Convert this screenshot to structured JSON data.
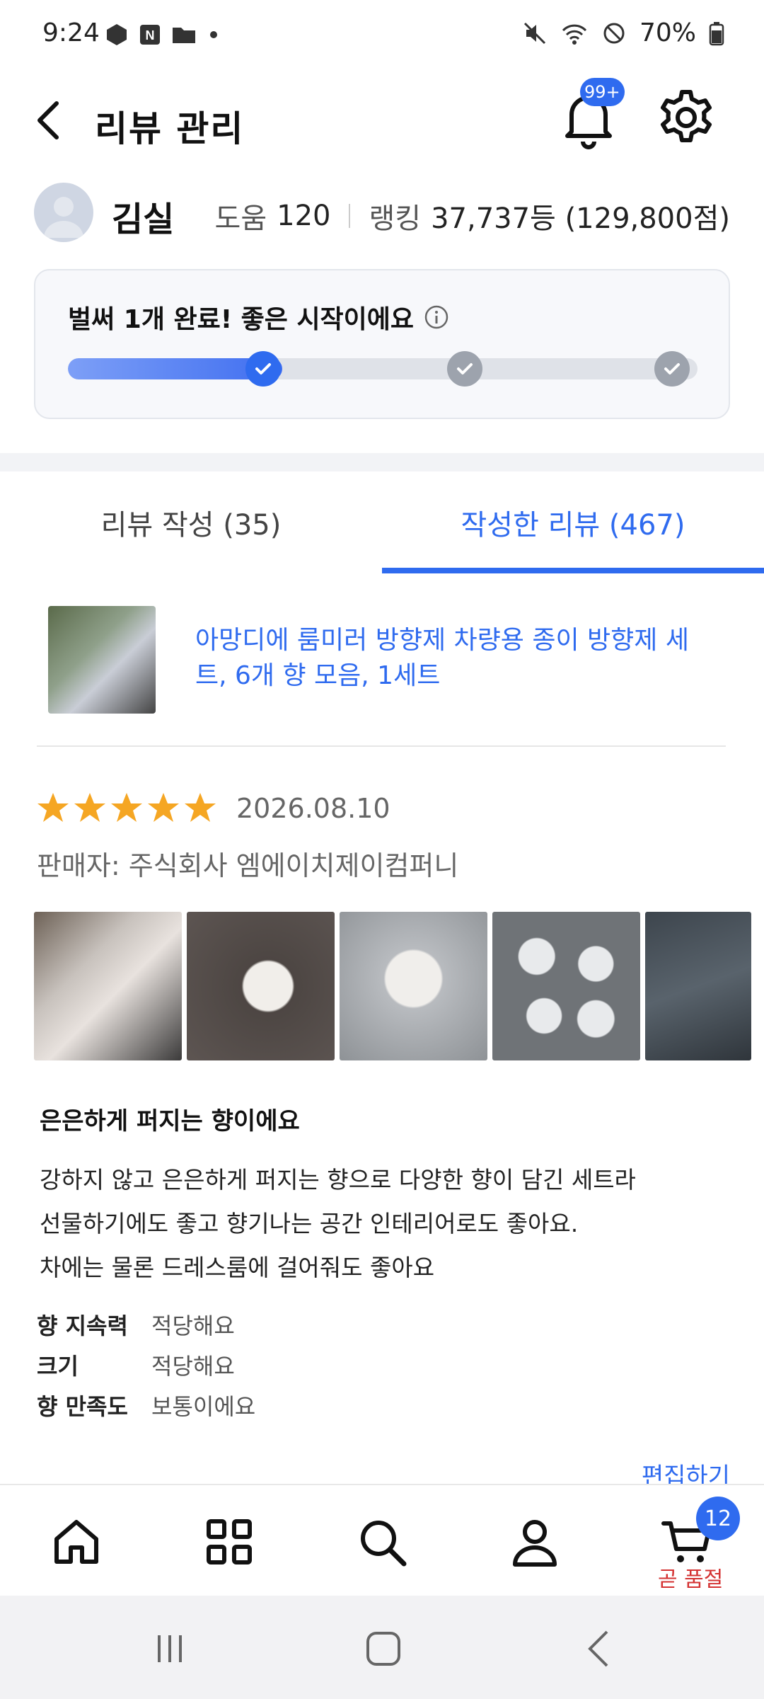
{
  "status_bar": {
    "time": "9:24",
    "battery": "70%"
  },
  "header": {
    "title": "리뷰 관리",
    "notification_badge": "99+"
  },
  "profile": {
    "name": "김실",
    "help_label": "도움",
    "help_value": "120",
    "ranking_label": "랭킹",
    "ranking_value": "37,737등 (129,800점)"
  },
  "progress_card": {
    "title": "벌써 1개 완료! 좋은 시작이에요",
    "completed_steps": 1,
    "total_steps": 3,
    "fill_fraction": 0.34
  },
  "tabs": [
    {
      "label": "리뷰 작성 (35)",
      "active": false
    },
    {
      "label": "작성한 리뷰 (467)",
      "active": true
    }
  ],
  "product": {
    "title": "아망디에 룸미러 방향제 차량용 종이 방향제 세트, 6개 향 모음, 1세트"
  },
  "review": {
    "rating": 5,
    "date": "2026.08.10",
    "seller": "판매자: 주식회사 엠에이치제이컴퍼니",
    "headline": "은은하게 퍼지는 향이에요",
    "body_lines": [
      "강하지 않고 은은하게 퍼지는 향으로 다양한 향이 담긴 세트라",
      "선물하기에도 좋고 향기나는 공간 인테리어로도 좋아요.",
      "차에는 물론 드레스룸에 걸어줘도 좋아요"
    ],
    "attributes": [
      {
        "key": "향 지속력",
        "value": "적당해요"
      },
      {
        "key": "크기",
        "value": "적당해요"
      },
      {
        "key": "향 만족도",
        "value": "보통이에요"
      }
    ],
    "edit_label": "편집하기"
  },
  "bottom_nav": {
    "cart_count": "12",
    "cart_note": "곧 품절"
  },
  "colors": {
    "accent": "#2f6bef",
    "star": "#f5a623",
    "warning": "#d43232"
  }
}
